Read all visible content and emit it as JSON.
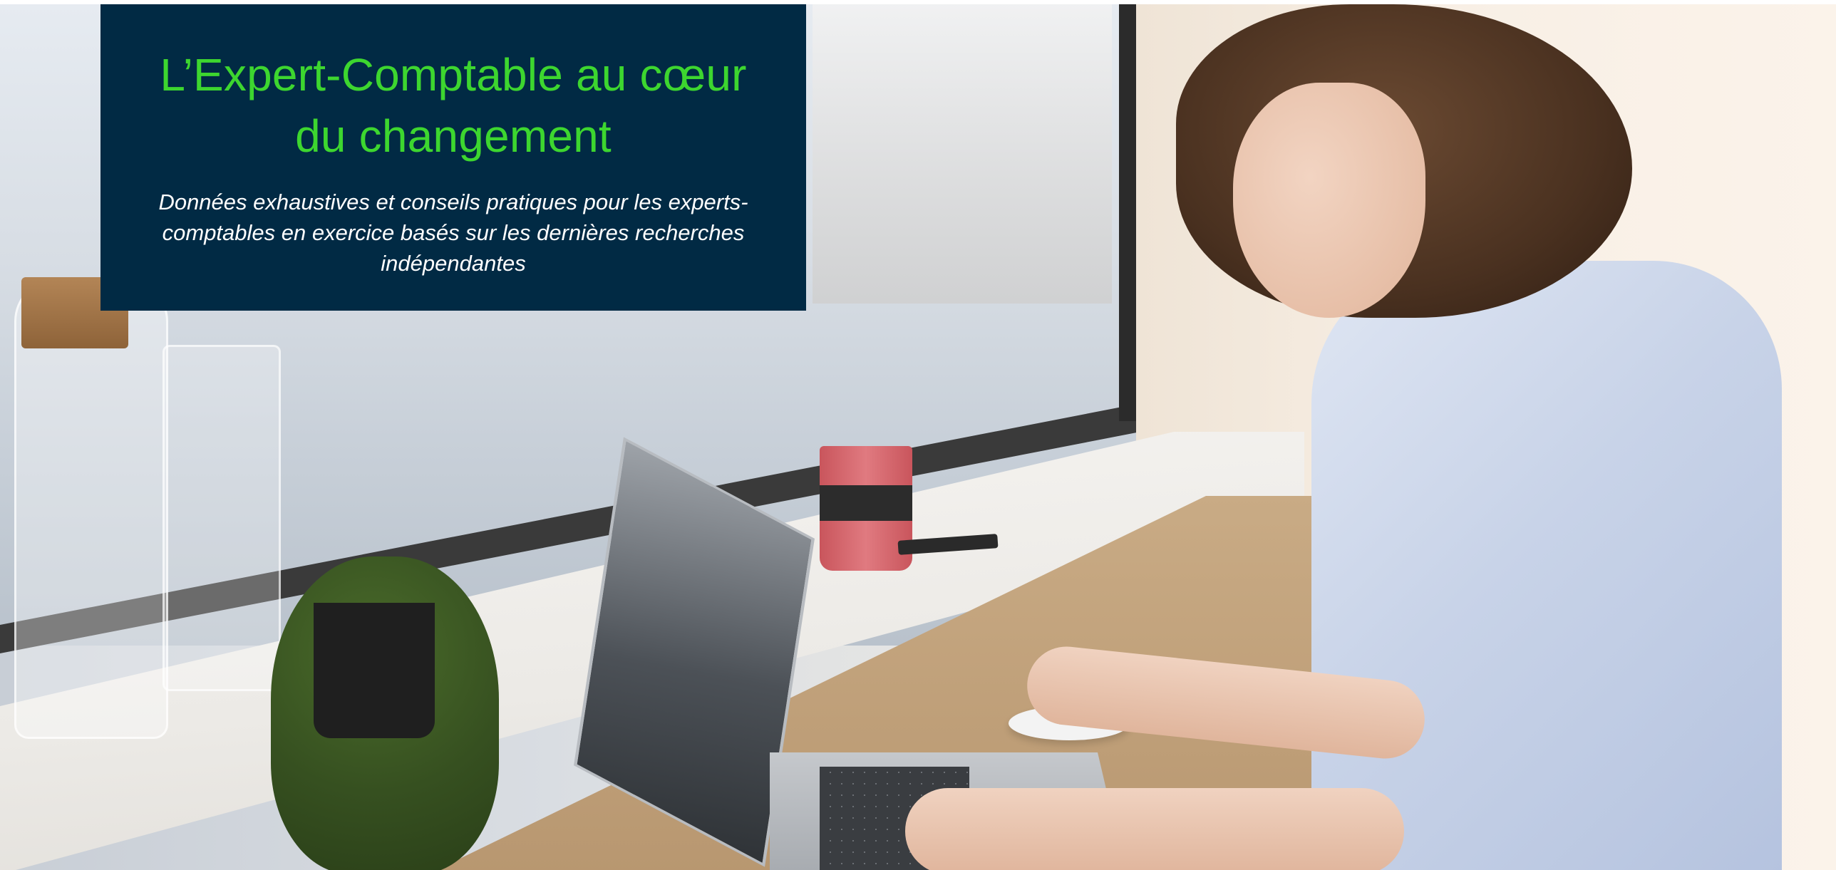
{
  "hero": {
    "title": "L’Expert-Comptable au cœur du changement",
    "subtitle": "Données exhaustives et conseils pratiques pour les experts-comptables en exercice basés sur les dernières recherches indépendantes"
  },
  "colors": {
    "panel_background": "#012a44",
    "title_color": "#3dd62f",
    "subtitle_color": "#ffffff"
  }
}
